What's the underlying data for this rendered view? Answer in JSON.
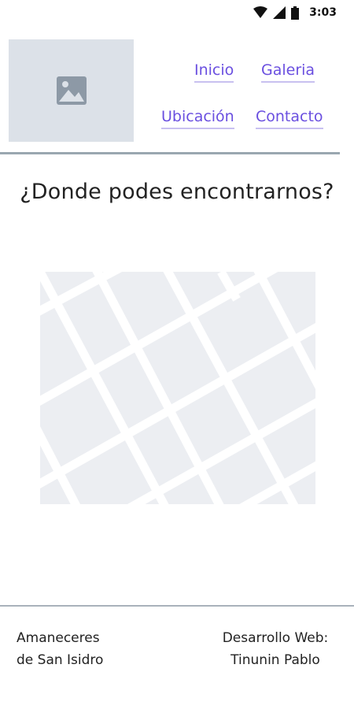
{
  "status_bar": {
    "time": "3:03",
    "icons": [
      "wifi-icon",
      "signal-icon",
      "battery-icon"
    ]
  },
  "header": {
    "logo_icon": "image-placeholder-icon",
    "nav": {
      "inicio": "Inicio",
      "galeria": "Galeria",
      "ubicacion": "Ubicación",
      "contacto": "Contacto"
    }
  },
  "main": {
    "title": "¿Donde podes encontrarnos?",
    "map_icon": "map-placeholder"
  },
  "footer": {
    "left_line1": "Amaneceres",
    "left_line2": "de San Isidro",
    "right_line1": "Desarrollo Web:",
    "right_line2": "Tinunin Pablo"
  },
  "colors": {
    "link": "#6a4fe0",
    "placeholder_bg": "#dce1e8",
    "map_bg": "#eceef2",
    "divider": "#9aa7b0"
  }
}
